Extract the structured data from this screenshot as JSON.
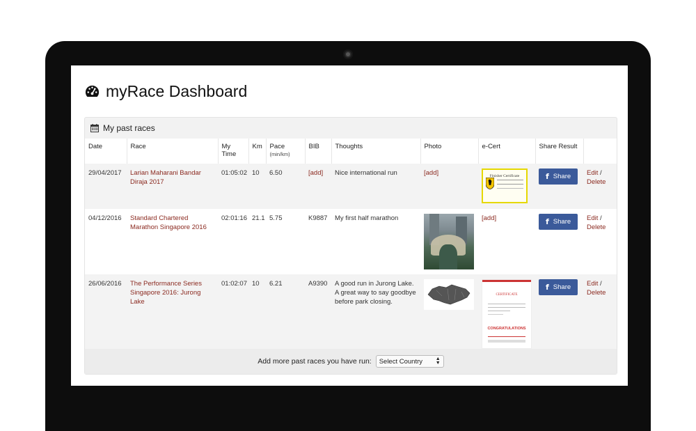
{
  "page": {
    "title": "myRace Dashboard"
  },
  "panel": {
    "heading": "My past races"
  },
  "table": {
    "headers": {
      "date": "Date",
      "race": "Race",
      "time_line1": "My",
      "time_line2": "Time",
      "km": "Km",
      "pace": "Pace",
      "pace_unit": "(min/km)",
      "bib": "BIB",
      "thoughts": "Thoughts",
      "photo": "Photo",
      "ecert": "e-Cert",
      "share": "Share Result"
    },
    "rows": [
      {
        "date": "29/04/2017",
        "race": "Larian Maharani Bandar Diraja 2017",
        "time": "01:05:02",
        "km": "10",
        "pace": "6.50",
        "bib": "[add]",
        "thoughts": "Nice international run",
        "photo": "[add]",
        "cert_title": "Finisher Certificate",
        "share": "Share",
        "edit": "Edit",
        "delete": "Delete"
      },
      {
        "date": "04/12/2016",
        "race": "Standard Chartered Marathon Singapore 2016",
        "time": "02:01:16",
        "km": "21.1",
        "pace": "5.75",
        "bib": "K9887",
        "thoughts": "My first half marathon",
        "ecert": "[add]",
        "share": "Share",
        "edit": "Edit",
        "delete": "Delete"
      },
      {
        "date": "26/06/2016",
        "race": "The Performance Series Singapore 2016: Jurong Lake",
        "time": "01:02:07",
        "km": "10",
        "pace": "6.21",
        "bib": "A9390",
        "thoughts": "A good run in Jurong Lake. A great way to say goodbye before park closing.",
        "cert_title": "CERTIFICATE",
        "cert_banner": "CONGRATULATIONS",
        "share": "Share",
        "edit": "Edit",
        "delete": "Delete"
      }
    ]
  },
  "footer": {
    "label": "Add more past races you have run:",
    "select_value": "Select Country"
  },
  "icons": {
    "title": "dashboard-icon",
    "panel": "calendar-icon",
    "share": "facebook-icon"
  },
  "colors": {
    "link": "#8b2a20",
    "facebook": "#3b5a9a"
  }
}
